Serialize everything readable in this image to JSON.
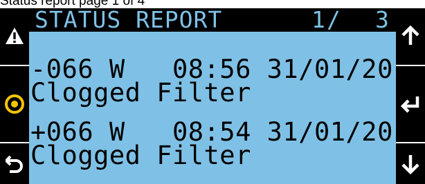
{
  "caption": "Status report page 1 of 4",
  "screen": {
    "title": "STATUS REPORT",
    "page_current": "1",
    "page_separator": "/",
    "page_total": "3",
    "entries": [
      {
        "line1": "-066 W   08:56 31/01/20",
        "line2": "Clogged Filter"
      },
      {
        "line1": "+066 W   08:54 31/01/20",
        "line2": "Clogged Filter"
      }
    ]
  },
  "buttons": {
    "left": [
      "alarm-icon",
      "target-icon",
      "back-icon"
    ],
    "right": [
      "up-arrow-icon",
      "enter-icon",
      "down-arrow-icon"
    ]
  },
  "colors": {
    "screen_bg": "#7fc1e6",
    "frame": "#000000",
    "target_accent": "#f2c500"
  }
}
